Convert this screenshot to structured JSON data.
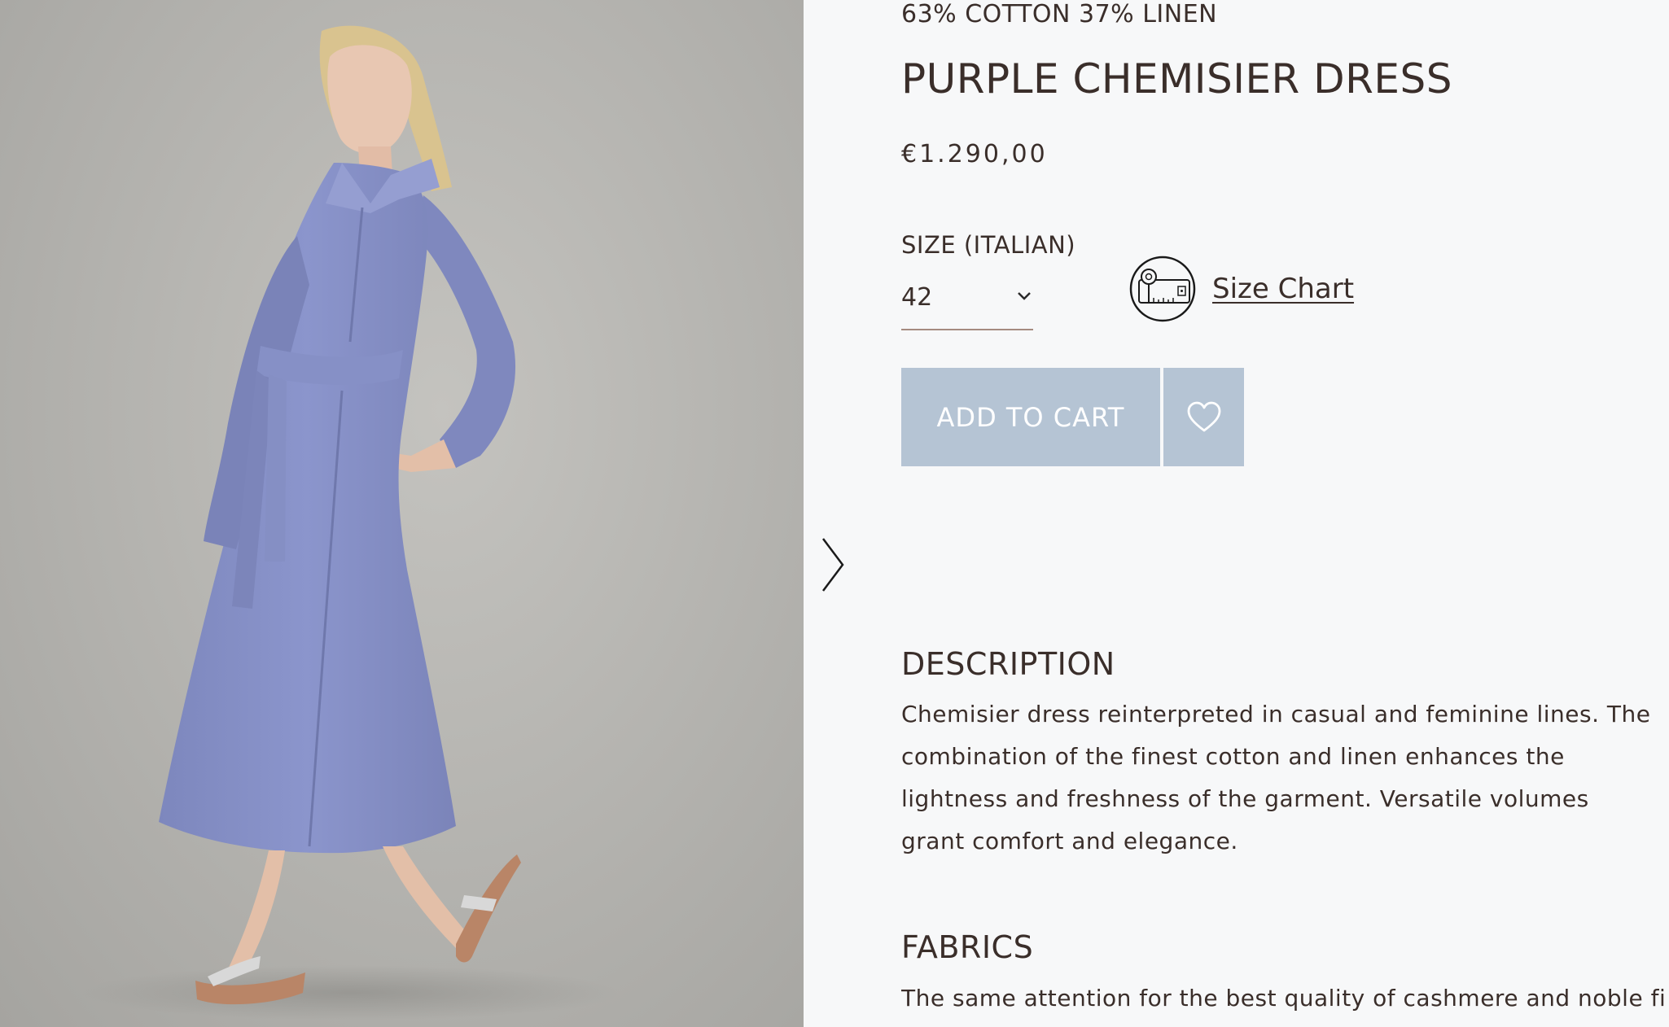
{
  "product_image": {
    "alt": "PURPLE CHEMISIER DRESS"
  },
  "carousel": {
    "next_icon": "chevron-right-icon"
  },
  "product": {
    "composition": "63% COTTON 37% LINEN",
    "title": "PURPLE CHEMISIER DRESS",
    "price": "€1.290,00"
  },
  "size": {
    "label": "SIZE (ITALIAN)",
    "selected": "42",
    "dropdown_icon": "chevron-down-icon",
    "chart_icon": "measuring-tape-icon",
    "chart_label": "Size Chart"
  },
  "actions": {
    "add_to_cart": "ADD TO CART",
    "wishlist_icon": "heart-outline-icon"
  },
  "description": {
    "heading": "DESCRIPTION",
    "text": "Chemisier dress reinterpreted in casual and feminine lines. The combination of the finest cotton and linen enhances the lightness and freshness of the garment. Versatile volumes grant comfort and elegance."
  },
  "fabrics": {
    "heading": "FABRICS",
    "text": "The same attention for the best quality of cashmere and noble fibers"
  },
  "colors": {
    "text": "#3a2e2a",
    "button_bg": "#b5c4d4",
    "button_text": "#ffffff",
    "page_bg": "#f7f8f9",
    "dress": "#8791c6"
  }
}
